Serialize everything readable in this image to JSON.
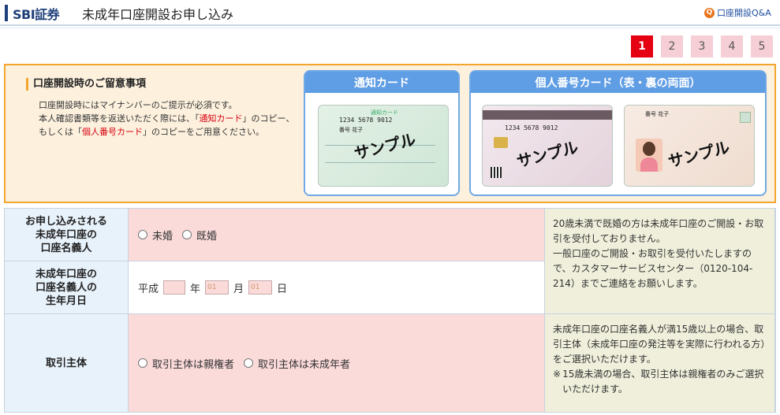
{
  "header": {
    "brand": "SBI証券",
    "title": "未成年口座開設お申し込み",
    "qa_label": "口座開設Q&A",
    "qa_icon": "Q"
  },
  "steps": [
    "1",
    "2",
    "3",
    "4",
    "5"
  ],
  "notice": {
    "heading": "口座開設時のご留意事項",
    "line1": "口座開設時にはマイナンバーのご提示が必須です。",
    "line2_pre": "本人確認書類等を返送いただく際には、「",
    "line2_red": "通知カード",
    "line2_post": "」のコピー、",
    "line3_pre": "もしくは「",
    "line3_red": "個人番号カード",
    "line3_post": "」のコピーをご用意ください。",
    "card1_title": "通知カード",
    "card2_title": "個人番号カード（表・裏の両面）",
    "sample_label": "サンプル",
    "card1_header": "通知カード",
    "card1_number": "1234 5678 9012",
    "card1_name": "番号 花子",
    "card2_number": "1234 5678 9012",
    "card3_name": "番号 花子"
  },
  "form": {
    "row1_label": [
      "お申し込みされる",
      "未成年口座の",
      "口座名義人"
    ],
    "row1_options": [
      "未婚",
      "既婚"
    ],
    "row2_label": [
      "未成年口座の",
      "口座名義人の",
      "生年月日"
    ],
    "era": "平成",
    "year_unit": "年",
    "month_value": "01",
    "month_unit": "月",
    "day_value": "01",
    "day_unit": "日",
    "row3_label": "取引主体",
    "row3_options": [
      "取引主体は親権者",
      "取引主体は未成年者"
    ],
    "info1": "20歳未満で既婚の方は未成年口座のご開設・お取引を受付しておりません。\n一般口座のご開設・お取引を受付いたしますので、カスタマーサービスセンター（0120-104-214）までご連絡をお願いします。",
    "info2_main": "未成年口座の口座名義人が満15歳以上の場合、取引主体（未成年口座の発注等を実際に行われる方）をご選択いただけます。",
    "info2_note_mark": "※",
    "info2_note": "15歳未満の場合、取引主体は親権者のみご選択いただけます。"
  },
  "colors": {
    "accent": "#e50012",
    "brand": "#1f3f7a",
    "notice_border": "#f3a52d",
    "panel_blue": "#5f9de4",
    "pink_cell": "#fbdada",
    "info_cell": "#efefdb"
  }
}
